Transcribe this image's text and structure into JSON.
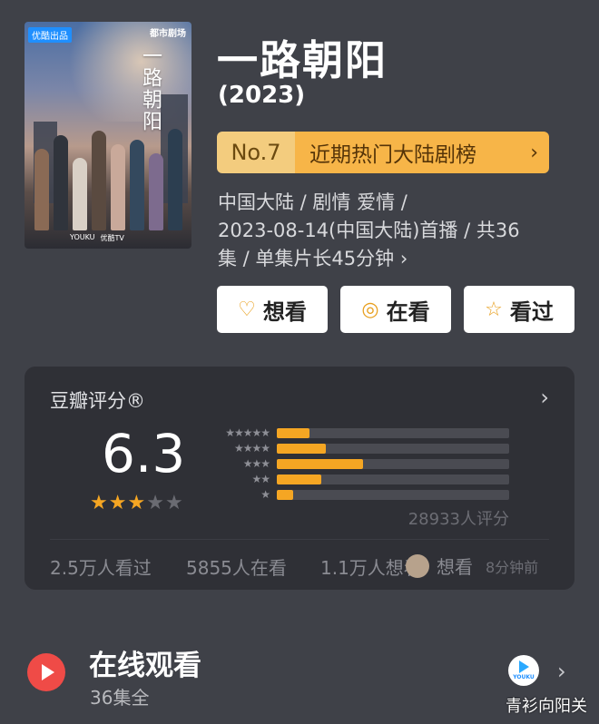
{
  "poster": {
    "badge": "优酷出品",
    "brand": "都市剧场",
    "title_art": "一路朝阳",
    "logos": [
      "YOUKU",
      "优酷TV"
    ]
  },
  "movie": {
    "title": "一路朝阳",
    "year": "(2023)"
  },
  "rank": {
    "number": "No.7",
    "label": "近期热门大陆剧榜",
    "chevron": "›"
  },
  "meta": {
    "line1": "中国大陆 / 剧情 爱情 /",
    "line2": "2023-08-14(中国大陆)首播 / 共36",
    "line3": "集 / 单集片长45分钟 ›"
  },
  "actions": {
    "want": {
      "label": "想看",
      "icon": "heart-plus-icon",
      "glyph": "♡"
    },
    "watching": {
      "label": "在看",
      "icon": "target-icon",
      "glyph": "◎"
    },
    "watched": {
      "label": "看过",
      "icon": "star-outline-icon",
      "glyph": "☆"
    }
  },
  "rating": {
    "title": "豆瓣评分®",
    "chevron": "›",
    "score": "6.3",
    "stars_filled": 3,
    "stars_total": 5,
    "count_text": "28933人评分",
    "distribution": [
      {
        "stars": "★★★★★",
        "fraction": 0.14
      },
      {
        "stars": "★★★★",
        "fraction": 0.21
      },
      {
        "stars": "★★★",
        "fraction": 0.37
      },
      {
        "stars": "★★",
        "fraction": 0.19
      },
      {
        "stars": "★",
        "fraction": 0.07
      }
    ],
    "accent_color": "#f5a623"
  },
  "stats": {
    "watched": "2.5万人看过",
    "watching": "5855人在看",
    "want": "1.1万人想看"
  },
  "friend": {
    "action": "想看",
    "time": "8分钟前"
  },
  "online": {
    "title": "在线观看",
    "subtitle": "36集全",
    "platform": "YOUKU",
    "chevron": "›"
  },
  "watermark": "青衫向阳关"
}
